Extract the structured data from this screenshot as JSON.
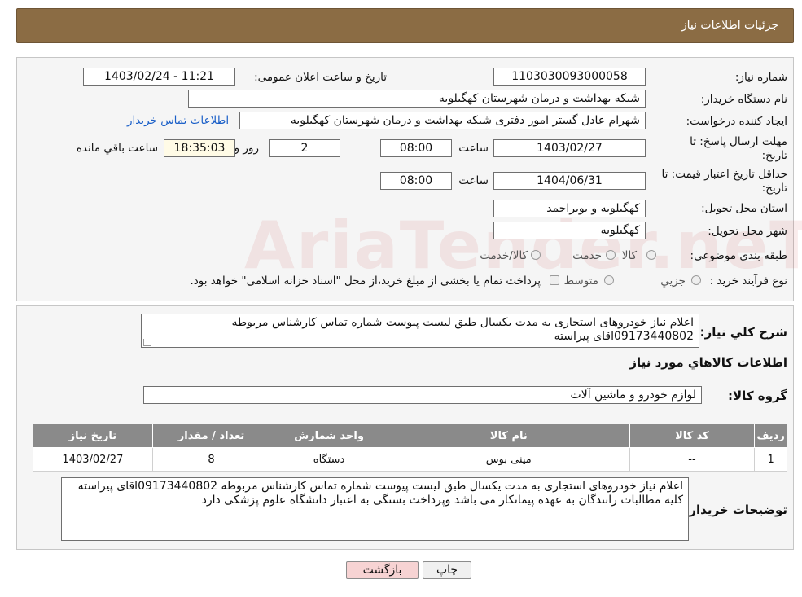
{
  "header": {
    "title": "جزئیات اطلاعات نیاز"
  },
  "form": {
    "need_number_label": "شماره نیاز:",
    "need_number": "1103030093000058",
    "announce_label": "تاریخ و ساعت اعلان عمومی:",
    "announce_value": "1403/02/24 - 11:21",
    "buyer_org_label": "نام دستگاه خریدار:",
    "buyer_org": "شبکه بهداشت و درمان شهرستان کهگیلویه",
    "requester_label": "ایجاد کننده درخواست:",
    "requester": "شهرام عادل گستر امور دفتری شبکه بهداشت و درمان شهرستان کهگیلویه",
    "contact_link": "اطلاعات تماس خریدار",
    "reply_deadline_label_1": "مهلت ارسال پاسخ: تا",
    "reply_deadline_label_2": "تاریخ:",
    "reply_date": "1403/02/27",
    "time_label": "ساعت",
    "reply_time": "08:00",
    "days_value": "2",
    "days_label": "روز و",
    "remaining_time": "18:35:03",
    "remaining_label": "ساعت باقي مانده",
    "validity_label_1": "حداقل تاریخ اعتبار قیمت: تا",
    "validity_label_2": "تاریخ:",
    "validity_date": "1404/06/31",
    "validity_time_label": "ساعت",
    "validity_time": "08:00",
    "province_label": "استان محل تحویل:",
    "province": "کهگیلویه و بویراحمد",
    "city_label": "شهر محل تحویل:",
    "city": "کهگیلویه",
    "category_label": "طبقه بندی موضوعی:",
    "category_options": [
      "کالا",
      "خدمت",
      "کالا/خدمت"
    ],
    "process_label": "نوع فرآیند خرید :",
    "process_options": [
      "جزیي",
      "متوسط"
    ],
    "process_note": "پرداخت تمام یا بخشی از مبلغ خرید،از محل \"اسناد خزانه اسلامی\" خواهد بود."
  },
  "description": {
    "label": "شرح كلي نياز:",
    "text": "اعلام نیاز خودروهای استجاری به مدت یکسال طبق لیست پیوست شماره تماس کارشناس مربوطه 09173440802اقای پیراسته"
  },
  "goods": {
    "section_title": "اطلاعات كالاهاي مورد نياز",
    "group_label": "گروه کالا:",
    "group_value": "لوازم خودرو و ماشین آلات",
    "columns": [
      "ردیف",
      "کد کالا",
      "نام کالا",
      "واحد شمارش",
      "تعداد / مقدار",
      "تاریخ نیاز"
    ],
    "rows": [
      [
        "1",
        "--",
        "مینی بوس",
        "دستگاه",
        "8",
        "1403/02/27"
      ]
    ]
  },
  "buyer_notes": {
    "label": "توضیحات خریدار:",
    "text": "اعلام نیاز خودروهای استجاری به مدت یکسال طبق لیست پیوست شماره تماس کارشناس مربوطه 09173440802اقای پیراسته کلیه مطالبات رانندگان به عهده پیمانکار می باشد وپرداخت بستگی به اعتبار دانشگاه علوم پزشکی دارد"
  },
  "buttons": {
    "print": "چاپ",
    "back": "بازگشت"
  },
  "watermark": "AriaTender.neT",
  "colors": {
    "header_bg": "#8b6c44",
    "table_header_bg": "#8a8a8a",
    "back_button_bg": "#f7d3d3",
    "link": "#1a5fc8"
  }
}
